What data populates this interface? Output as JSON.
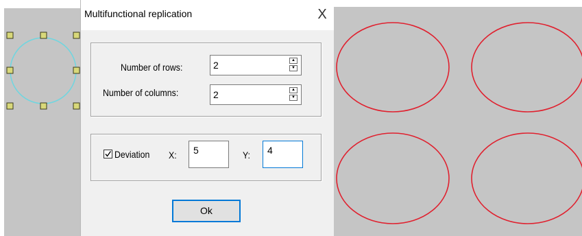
{
  "dialog": {
    "title": "Multifunctional replication",
    "close_glyph": "X",
    "rows_label": "Number of rows:",
    "rows_value": "2",
    "columns_label": "Number of columns:",
    "columns_value": "2",
    "deviation_label": "Deviation",
    "deviation_checked": true,
    "x_label": "X:",
    "x_value": "5",
    "y_label": "Y:",
    "y_value": "4",
    "ok_label": "Ok"
  },
  "canvas": {
    "background": "#c5c5c5",
    "selection_circle_color": "#6fd6e0",
    "handle_fill": "#d8d87a",
    "replica_color": "#e0202e",
    "replica_count": 4
  },
  "colors": {
    "dialog_bg": "#f0f0f0",
    "accent": "#0078d7"
  }
}
